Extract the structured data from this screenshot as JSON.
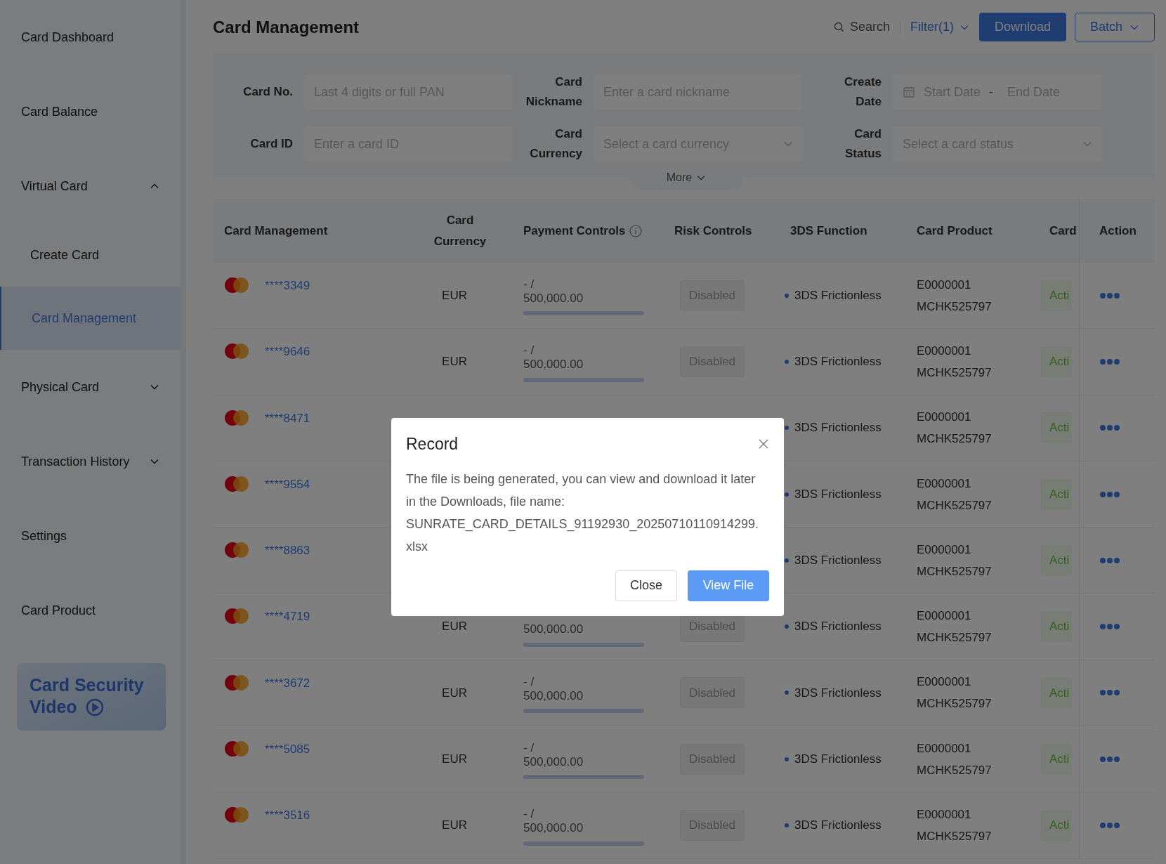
{
  "sidebar": {
    "items": [
      {
        "label": "Card Dashboard",
        "kind": "item",
        "selected": false
      },
      {
        "label": "Card Balance",
        "kind": "item",
        "selected": false
      },
      {
        "label": "Virtual Card",
        "kind": "group",
        "expanded": true,
        "children": [
          {
            "label": "Create Card",
            "kind": "item",
            "selected": false
          },
          {
            "label": "Card Management",
            "kind": "item",
            "selected": true
          }
        ]
      },
      {
        "label": "Physical Card",
        "kind": "group",
        "expanded": false
      },
      {
        "label": "Transaction History",
        "kind": "group",
        "expanded": false
      },
      {
        "label": "Settings",
        "kind": "item",
        "selected": false
      },
      {
        "label": "Card Product",
        "kind": "item",
        "selected": false
      }
    ],
    "banner": {
      "title_lines": [
        "Card Security",
        "Video"
      ]
    }
  },
  "header": {
    "title": "Card Management",
    "search": "Search",
    "filter": "Filter(1)",
    "download": "Download",
    "batch": "Batch"
  },
  "filters": {
    "fields": [
      {
        "label": "Card No.",
        "kind": "text",
        "placeholder": "Last 4 digits or full PAN"
      },
      {
        "label": "Card Nickname",
        "kind": "text",
        "placeholder": "Enter a card nickname"
      },
      {
        "label": "Create Date",
        "kind": "daterange",
        "start": "Start Date",
        "separator": "-",
        "end": "End Date"
      },
      {
        "label": "Card ID",
        "kind": "text",
        "placeholder": "Enter a card ID"
      },
      {
        "label": "Card Currency",
        "kind": "select",
        "placeholder": "Select a card currency"
      },
      {
        "label": "Card Status",
        "kind": "select",
        "placeholder": "Select a card status"
      }
    ],
    "more": "More"
  },
  "table": {
    "columns": [
      "Card Management",
      "Card Currency",
      "Payment Controls",
      "Risk Controls",
      "3DS Function",
      "Card Product",
      "Card",
      "Action"
    ],
    "rows": [
      {
        "card_no": "****3349",
        "currency": "EUR",
        "spent": "- /",
        "limit": "500,000.00",
        "risk": "Disabled",
        "tds": "3DS Frictionless",
        "product": [
          "E0000001",
          "MCHK525797"
        ],
        "status": "Acti"
      },
      {
        "card_no": "****9646",
        "currency": "EUR",
        "spent": "- /",
        "limit": "500,000.00",
        "risk": "Disabled",
        "tds": "3DS Frictionless",
        "product": [
          "E0000001",
          "MCHK525797"
        ],
        "status": "Acti"
      },
      {
        "card_no": "****8471",
        "tds": "3DS Frictionless",
        "product": [
          "E0000001",
          "MCHK525797"
        ],
        "status": "Acti"
      },
      {
        "card_no": "****9554",
        "tds": "3DS Frictionless",
        "product": [
          "E0000001",
          "MCHK525797"
        ],
        "status": "Acti"
      },
      {
        "card_no": "****8863",
        "tds": "3DS Frictionless",
        "product": [
          "E0000001",
          "MCHK525797"
        ],
        "status": "Acti"
      },
      {
        "card_no": "****4719",
        "currency": "EUR",
        "limit": "500,000.00",
        "risk": "Disabled",
        "tds": "3DS Frictionless",
        "product": [
          "E0000001",
          "MCHK525797"
        ],
        "status": "Acti"
      },
      {
        "card_no": "****3672",
        "currency": "EUR",
        "spent": "- /",
        "limit": "500,000.00",
        "risk": "Disabled",
        "tds": "3DS Frictionless",
        "product": [
          "E0000001",
          "MCHK525797"
        ],
        "status": "Acti"
      },
      {
        "card_no": "****5085",
        "currency": "EUR",
        "spent": "- /",
        "limit": "500,000.00",
        "risk": "Disabled",
        "tds": "3DS Frictionless",
        "product": [
          "E0000001",
          "MCHK525797"
        ],
        "status": "Acti"
      },
      {
        "card_no": "****3516",
        "currency": "EUR",
        "spent": "- /",
        "limit": "500,000.00",
        "risk": "Disabled",
        "tds": "3DS Frictionless",
        "product": [
          "E0000001",
          "MCHK525797"
        ],
        "status": "Acti"
      }
    ]
  },
  "dialog": {
    "title": "Record",
    "message": "The file is being generated, you can view and download it later in the Downloads, file name: SUNRATE_CARD_DETAILS_91192930_20250710110914299.xlsx",
    "buttons": [
      {
        "label": "Close",
        "kind": "secondary"
      },
      {
        "label": "View File",
        "kind": "primary"
      }
    ]
  }
}
